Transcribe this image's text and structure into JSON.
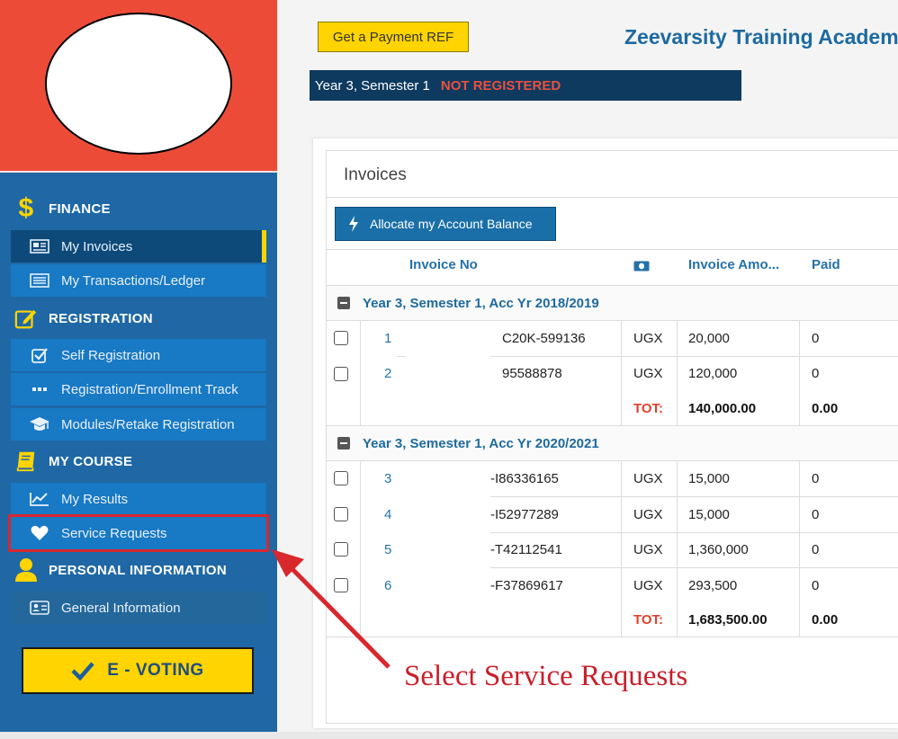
{
  "sidebar": {
    "sections": {
      "finance": "FINANCE",
      "registration": "REGISTRATION",
      "my_course": "MY COURSE",
      "personal": "PERSONAL INFORMATION"
    },
    "items": {
      "my_invoices": "My Invoices",
      "my_transactions": "My Transactions/Ledger",
      "self_registration": "Self Registration",
      "enrollment_track": "Registration/Enrollment Track",
      "modules_retake": "Modules/Retake Registration",
      "my_results": "My Results",
      "service_requests": "Service Requests",
      "general_information": "General Information"
    },
    "evoting": "E - VOTING"
  },
  "header": {
    "payment_ref_button": "Get a Payment REF",
    "school_name": "Zeevarsity Training Academy",
    "semester": "Year 3, Semester 1",
    "registration_status": "NOT REGISTERED"
  },
  "invoices": {
    "title": "Invoices",
    "allocate_button": "Allocate my Account Balance",
    "columns": {
      "invoice_no": "Invoice No",
      "invoice_amount": "Invoice Amo...",
      "paid": "Paid"
    },
    "groups": [
      {
        "label": "Year 3, Semester 1, Acc Yr 2018/2019",
        "rows": [
          {
            "index": "1",
            "invoice_no": "C20K-599136",
            "currency": "UGX",
            "amount": "20,000",
            "paid": "0"
          },
          {
            "index": "2",
            "invoice_no": "95588878",
            "currency": "UGX",
            "amount": "120,000",
            "paid": "0"
          }
        ],
        "total_label": "TOT:",
        "total_amount": "140,000.00",
        "total_paid": "0.00"
      },
      {
        "label": "Year 3, Semester 1, Acc Yr 2020/2021",
        "rows": [
          {
            "index": "3",
            "invoice_no": "-I86336165",
            "currency": "UGX",
            "amount": "15,000",
            "paid": "0"
          },
          {
            "index": "4",
            "invoice_no": "-I52977289",
            "currency": "UGX",
            "amount": "15,000",
            "paid": "0"
          },
          {
            "index": "5",
            "invoice_no": "-T42112541",
            "currency": "UGX",
            "amount": "1,360,000",
            "paid": "0"
          },
          {
            "index": "6",
            "invoice_no": "-F37869617",
            "currency": "UGX",
            "amount": "293,500",
            "paid": "0"
          }
        ],
        "total_label": "TOT:",
        "total_amount": "1,683,500.00",
        "total_paid": "0.00"
      }
    ]
  },
  "annotation": "Select Service Requests",
  "colors": {
    "sidebar": "#1f68a5",
    "sidebar_top": "#ec4c37",
    "accent_yellow": "#ffd400",
    "status_bar": "#0e3a60",
    "highlight_red": "#d9272e"
  }
}
